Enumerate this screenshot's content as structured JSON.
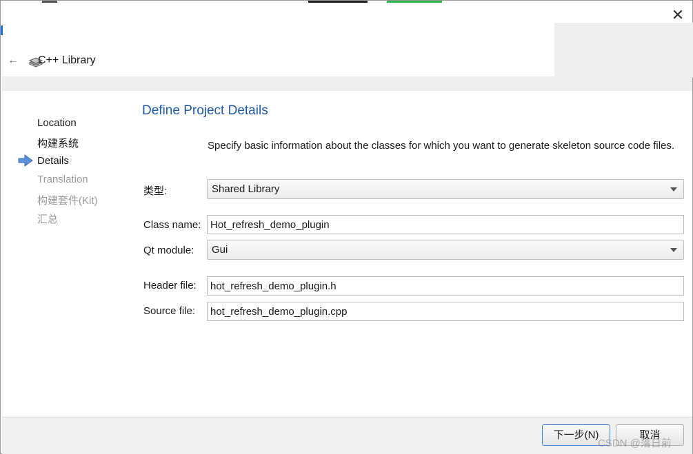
{
  "window": {
    "close_glyph": "✕"
  },
  "header": {
    "back_glyph": "←",
    "icon": "library-icon",
    "title": "C++ Library"
  },
  "steps": [
    {
      "label": "Location",
      "state": "done"
    },
    {
      "label": "构建系统",
      "state": "done"
    },
    {
      "label": "Details",
      "state": "current"
    },
    {
      "label": "Translation",
      "state": "future"
    },
    {
      "label": "构建套件(Kit)",
      "state": "future"
    },
    {
      "label": "汇总",
      "state": "future"
    }
  ],
  "main": {
    "title": "Define Project Details",
    "description": "Specify basic information about the classes for which you want to generate skeleton source code files.",
    "type_label": "类型:",
    "type_value": "Shared Library",
    "class_name_label": "Class name:",
    "class_name_value": "Hot_refresh_demo_plugin",
    "qt_module_label": "Qt module:",
    "qt_module_value": "Gui",
    "header_file_label": "Header file:",
    "header_file_value": "hot_refresh_demo_plugin.h",
    "source_file_label": "Source file:",
    "source_file_value": "hot_refresh_demo_plugin.cpp"
  },
  "footer": {
    "next_label": "下一步(N)",
    "cancel_label": "取消",
    "watermark": "CSDN @落日前"
  },
  "colors": {
    "accent": "#1e5aa8",
    "current_step_arrow": "#5b8fd6"
  }
}
